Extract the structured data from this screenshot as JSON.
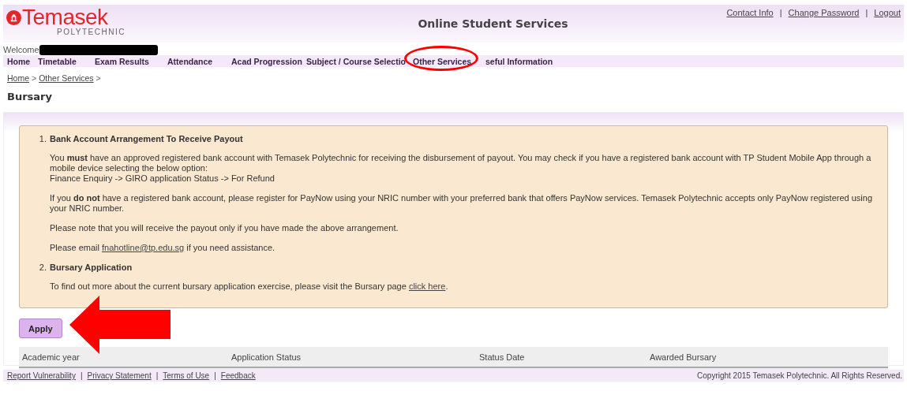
{
  "header": {
    "logo_name": "Temasek",
    "logo_subtitle": "POLYTECHNIC",
    "title": "Online Student Services",
    "top_links": [
      "Contact Info",
      "Change Password",
      "Logout"
    ],
    "separator": "|",
    "welcome": "Welcome"
  },
  "nav": [
    {
      "label": "Home",
      "selected": false
    },
    {
      "label": "Timetable",
      "selected": false
    },
    {
      "label": "Exam Results",
      "selected": false
    },
    {
      "label": "Attendance",
      "selected": false
    },
    {
      "label": "Acad Progression",
      "selected": false
    },
    {
      "label": "Subject / Course Selectio",
      "selected": false
    },
    {
      "label": "Other Services",
      "selected": false
    },
    {
      "label": "seful Information",
      "selected": false
    }
  ],
  "breadcrumb": [
    "Home",
    "Other Services"
  ],
  "breadcrumb_separator": ">",
  "page_title": "Bursary",
  "notice": [
    {
      "number": "1.",
      "title": "Bank Account Arrangement To Receive Payout",
      "paragraphs": [
        {
          "lines": [
            "You **must** have an approved registered bank account with Temasek Polytechnic for receiving the disbursement of payout. You may check if you have a registered bank account with TP Student Mobile App through a mobile device selecting the below option:",
            "Finance Enquiry -> GIRO application Status -> For Refund"
          ]
        },
        {
          "lines": [
            "If you **do not** have a registered bank account, please register for PayNow using your NRIC number with your preferred bank that offers PayNow services. Temasek Polytechnic accepts only PayNow registered using your NRIC number."
          ]
        },
        {
          "lines": [
            "Please note that you will receive the payout only if you have made the above arrangement."
          ]
        },
        {
          "lines": [
            "Please email"
          ],
          "link": "fnahotline@tp.edu.sg",
          "after": "if you need assistance."
        }
      ]
    },
    {
      "number": "2.",
      "title": "Bursary Application",
      "paragraphs": [
        {
          "lines": [
            "To find out more about the current bursary application exercise, please visit the Bursary page"
          ],
          "link": "click here",
          "after": "."
        }
      ]
    }
  ],
  "apply_button": "Apply",
  "table": {
    "columns": [
      "Academic year",
      "Application Status",
      "Status Date",
      "Awarded Bursary"
    ]
  },
  "footer": {
    "separator": "|",
    "links": [
      "Report Vulnerability",
      "Privacy Statement",
      "Terms of Use",
      "Feedback"
    ],
    "copyright": "Copyright 2015 Temasek Polytechnic. All Rights Reserved."
  }
}
